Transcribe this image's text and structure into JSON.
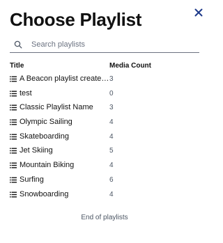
{
  "header": {
    "title": "Choose Playlist"
  },
  "icons": {
    "close": "close-icon",
    "search": "search-icon",
    "list": "list-icon"
  },
  "colors": {
    "close": "#1e3a8a",
    "text": "#111111",
    "muted": "#4b5563"
  },
  "search": {
    "placeholder": "Search playlists",
    "value": ""
  },
  "table": {
    "columns": [
      "Title",
      "Media Count"
    ],
    "rows": [
      {
        "title": "A Beacon playlist created...",
        "count": "3"
      },
      {
        "title": "test",
        "count": "0"
      },
      {
        "title": "Classic Playlist Name",
        "count": "3"
      },
      {
        "title": "Olympic Sailing",
        "count": "4"
      },
      {
        "title": "Skateboarding",
        "count": "4"
      },
      {
        "title": "Jet Skiing",
        "count": "5"
      },
      {
        "title": "Mountain Biking",
        "count": "4"
      },
      {
        "title": "Surfing",
        "count": "6"
      },
      {
        "title": "Snowboarding",
        "count": "4"
      }
    ]
  },
  "footer": {
    "end_text": "End of playlists"
  }
}
